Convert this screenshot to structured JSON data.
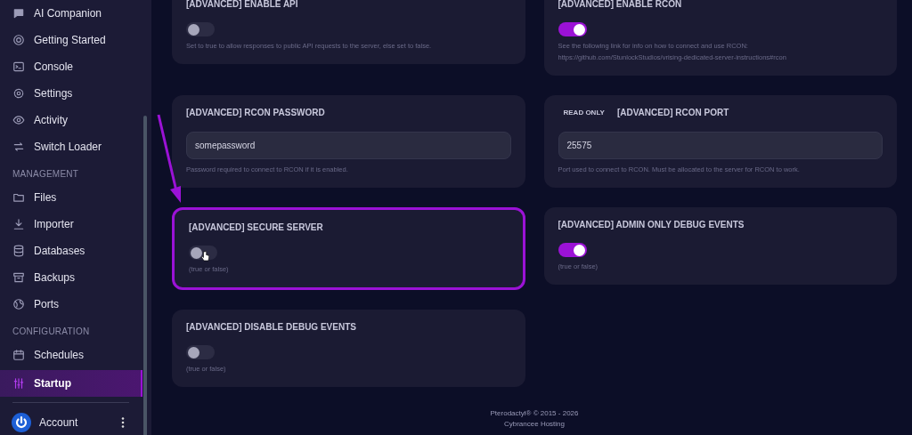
{
  "sidebar": {
    "groups": [
      {
        "items": [
          {
            "label": "AI Companion",
            "selected": false
          },
          {
            "label": "Getting Started",
            "selected": false
          },
          {
            "label": "Console",
            "selected": false
          },
          {
            "label": "Settings",
            "selected": false
          },
          {
            "label": "Activity",
            "selected": false
          },
          {
            "label": "Switch Loader",
            "selected": false
          }
        ]
      },
      {
        "heading": "MANAGEMENT",
        "items": [
          {
            "label": "Files",
            "selected": false
          },
          {
            "label": "Importer",
            "selected": false
          },
          {
            "label": "Databases",
            "selected": false
          },
          {
            "label": "Backups",
            "selected": false
          },
          {
            "label": "Ports",
            "selected": false
          }
        ]
      },
      {
        "heading": "CONFIGURATION",
        "items": [
          {
            "label": "Schedules",
            "selected": false
          },
          {
            "label": "Startup",
            "selected": true
          }
        ]
      }
    ],
    "account": {
      "label": "Account"
    }
  },
  "variables": [
    {
      "kind": "toggle",
      "title": "[ADVANCED] ENABLE API",
      "on": false,
      "description": "Set to true to allow responses to public API requests to the server, else set to false.",
      "highlighted": false
    },
    {
      "kind": "toggle",
      "title": "[ADVANCED] ENABLE RCON",
      "on": true,
      "description": "See the following link for info on how to connect and use RCON: https://github.com/StunlockStudios/vrising-dedicated-server-instructions#rcon",
      "highlighted": false
    },
    {
      "kind": "text",
      "title": "[ADVANCED] RCON PASSWORD",
      "value": "somepassword",
      "description": "Password required to connect to RCON if it is enabled.",
      "highlighted": false
    },
    {
      "kind": "text",
      "title": "[ADVANCED] RCON PORT",
      "badge": "READ ONLY",
      "value": "25575",
      "description": "Port used to connect to RCON. Must be allocated to the server for RCON to work.",
      "highlighted": false
    },
    {
      "kind": "toggle",
      "title": "[ADVANCED] SECURE SERVER",
      "on": false,
      "description": "(true or false)",
      "highlighted": true
    },
    {
      "kind": "toggle",
      "title": "[ADVANCED] ADMIN ONLY DEBUG EVENTS",
      "on": true,
      "description": "(true or false)",
      "highlighted": false
    },
    {
      "kind": "toggle",
      "title": "[ADVANCED] DISABLE DEBUG EVENTS",
      "on": false,
      "description": "(true or false)",
      "highlighted": false
    }
  ],
  "footer": {
    "lines": [
      "Pterodactyl® © 2015 - 2026",
      "Cybrancee Hosting"
    ]
  }
}
